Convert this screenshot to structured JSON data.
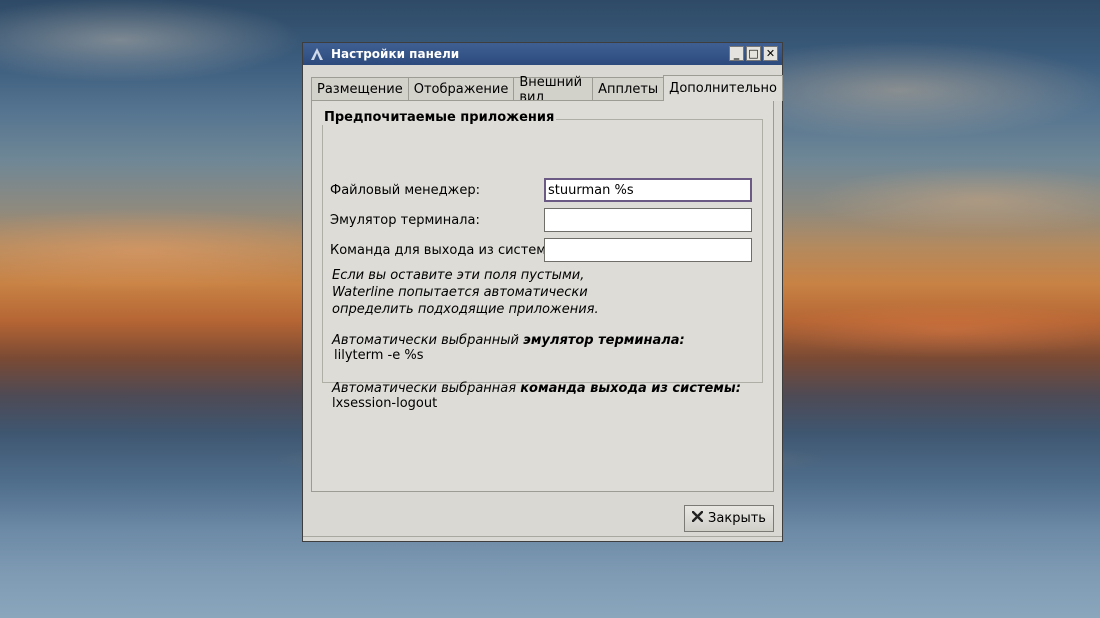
{
  "window": {
    "title": "Настройки панели",
    "buttons": {
      "minimize": "_",
      "maximize": "□",
      "close": "✕"
    }
  },
  "tabs": [
    {
      "label": "Размещение",
      "active": false
    },
    {
      "label": "Отображение",
      "active": false
    },
    {
      "label": "Внешний вид",
      "active": false
    },
    {
      "label": "Апплеты",
      "active": false
    },
    {
      "label": "Дополнительно",
      "active": true
    }
  ],
  "preferred_apps": {
    "title": "Предпочитаемые приложения",
    "file_manager": {
      "label": "Файловый менеджер:",
      "value": "stuurman %s"
    },
    "terminal": {
      "label": "Эмулятор терминала:",
      "value": ""
    },
    "logout": {
      "label": "Команда для выхода из системы:",
      "value": ""
    },
    "hint_line1": "Если вы оставите эти поля пустыми,",
    "hint_line2": "Waterline попытается автоматически",
    "hint_line3": "определить подходящие приложения.",
    "auto_terminal_prefix": "Автоматически выбранный ",
    "auto_terminal_bold": "эмулятор терминала:",
    "auto_terminal_value": "lilyterm -e %s",
    "auto_logout_prefix": "Автоматически выбранная ",
    "auto_logout_bold": "команда выхода из системы:",
    "auto_logout_value": "lxsession-logout"
  },
  "close_button": {
    "icon": "close-x-icon",
    "label": "Закрыть"
  }
}
